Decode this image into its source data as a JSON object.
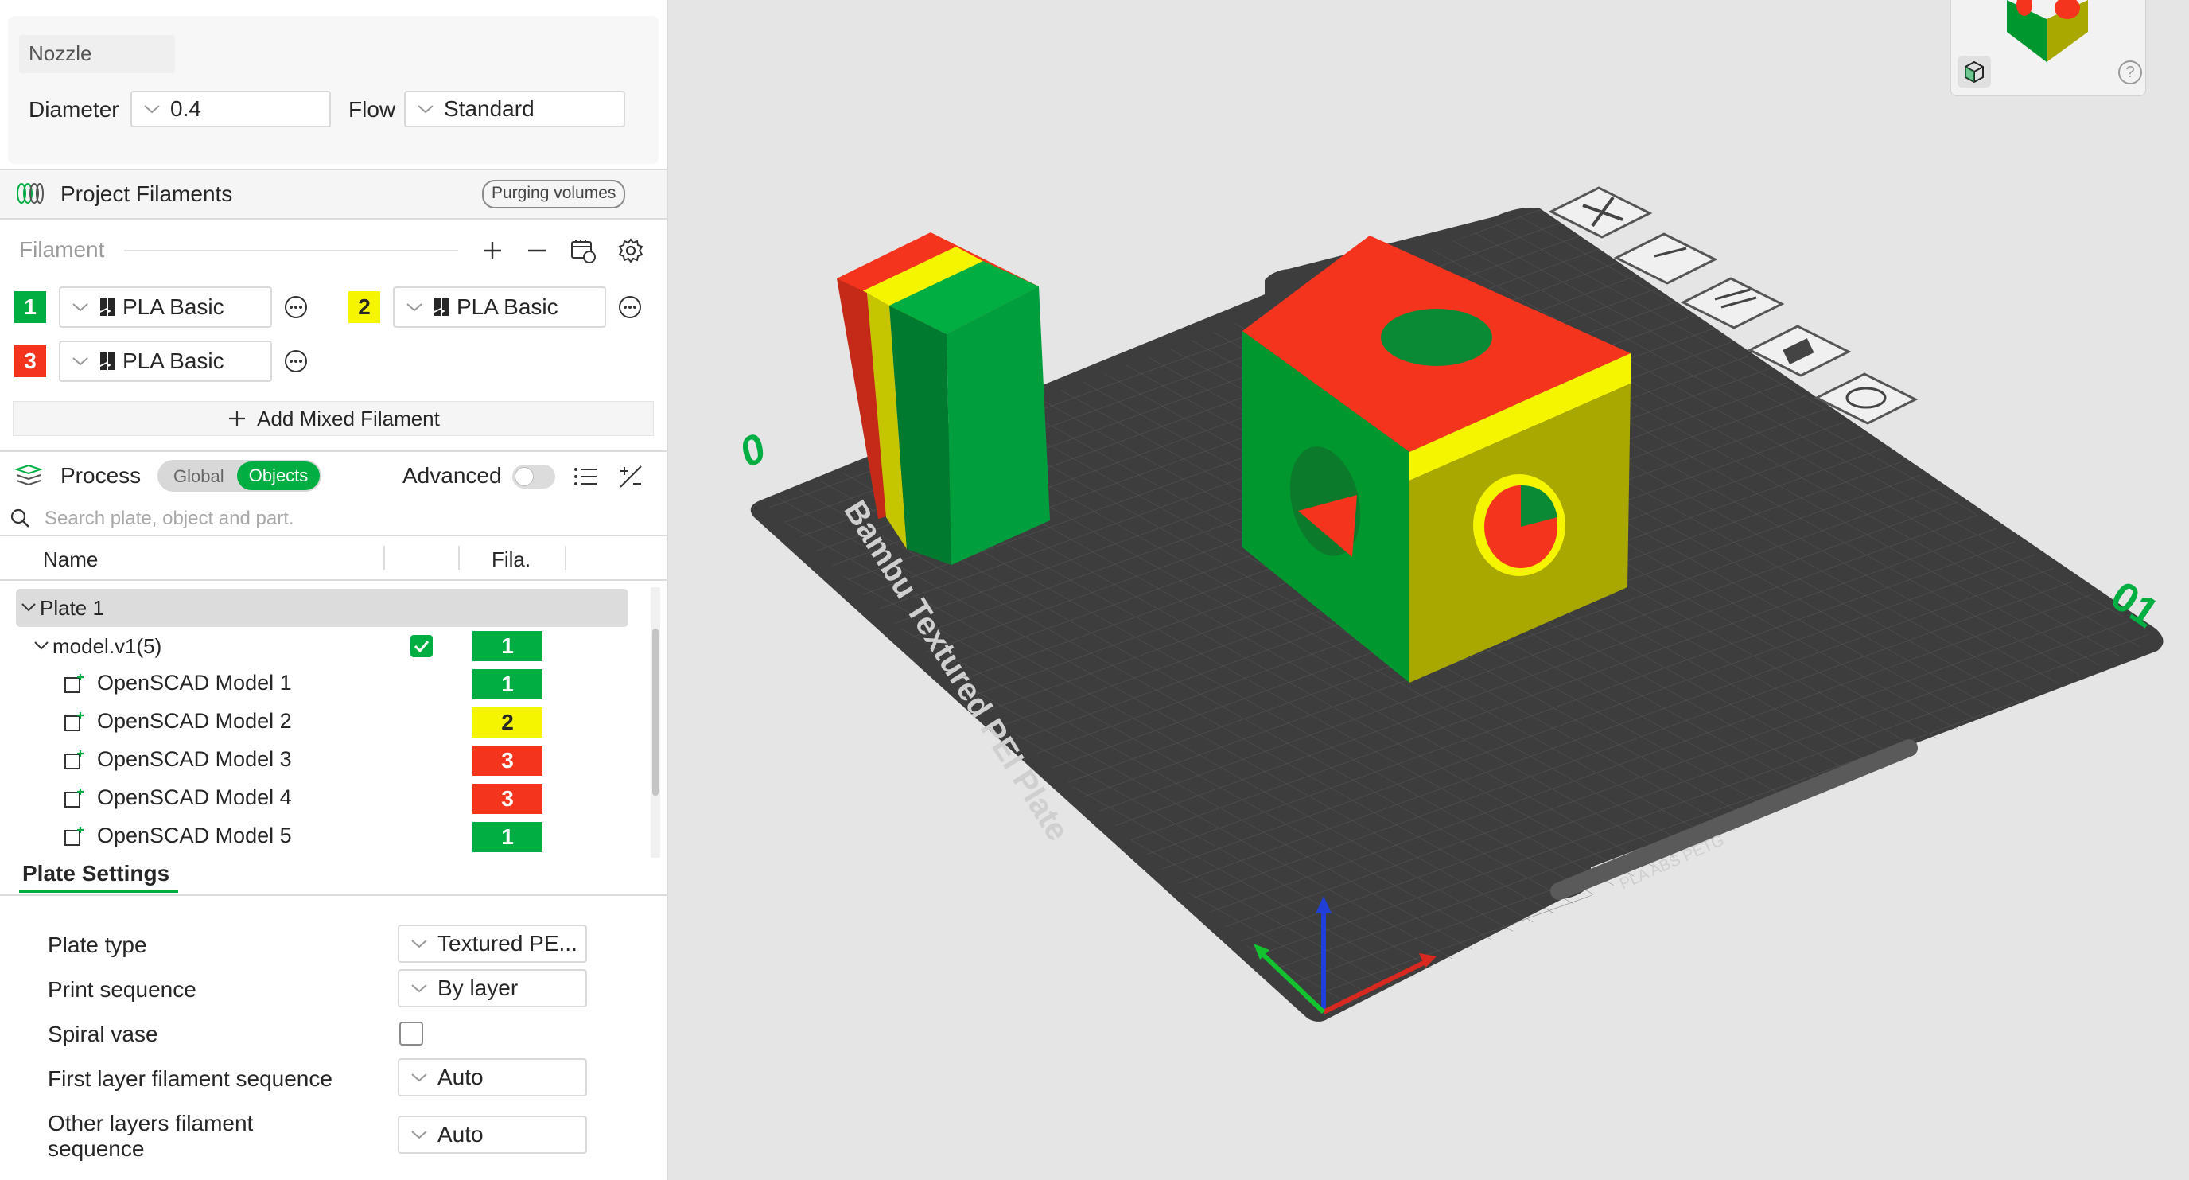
{
  "nozzle": {
    "section_label": "Nozzle",
    "diameter_label": "Diameter",
    "diameter_value": "0.4",
    "flow_label": "Flow",
    "flow_value": "Standard"
  },
  "filaments": {
    "header": "Project Filaments",
    "purging_button": "Purging volumes",
    "label": "Filament",
    "items": [
      {
        "num": "1",
        "name": "PLA Basic",
        "color": "#00ae42",
        "text_color": "#ffffff"
      },
      {
        "num": "2",
        "name": "PLA Basic",
        "color": "#f5f500",
        "text_color": "#262626"
      },
      {
        "num": "3",
        "name": "PLA Basic",
        "color": "#f5341d",
        "text_color": "#ffffff"
      }
    ],
    "add_mixed": "Add Mixed Filament"
  },
  "process": {
    "label": "Process",
    "toggle_global": "Global",
    "toggle_objects": "Objects",
    "advanced_label": "Advanced",
    "search_placeholder": "Search plate, object and part."
  },
  "object_list": {
    "col_name": "Name",
    "col_fila": "Fila.",
    "plate": "Plate 1",
    "model": {
      "name": "model.v1(5)",
      "fila": "1"
    },
    "parts": [
      {
        "name": "OpenSCAD Model 1",
        "fila": "1"
      },
      {
        "name": "OpenSCAD Model 2",
        "fila": "2"
      },
      {
        "name": "OpenSCAD Model 3",
        "fila": "3"
      },
      {
        "name": "OpenSCAD Model 4",
        "fila": "3"
      },
      {
        "name": "OpenSCAD Model 5",
        "fila": "1"
      }
    ]
  },
  "plate_settings": {
    "tab": "Plate Settings",
    "plate_type_label": "Plate type",
    "plate_type_value": "Textured PE...",
    "print_sequence_label": "Print sequence",
    "print_sequence_value": "By layer",
    "spiral_vase_label": "Spiral vase",
    "first_layer_label": "First layer filament sequence",
    "first_layer_value": "Auto",
    "other_layers_label": "Other layers filament sequence",
    "other_layers_value": "Auto"
  },
  "viewport": {
    "bed_text": "Bambu Textured PEI Plate",
    "bed_label_left": "0",
    "bed_label_right": "01",
    "bed_small_text": "PLA ABS PETG",
    "help_icon": "?"
  },
  "colors": {
    "accent_green": "#00ae42",
    "red": "#f5341d",
    "yellow": "#f5f500"
  }
}
